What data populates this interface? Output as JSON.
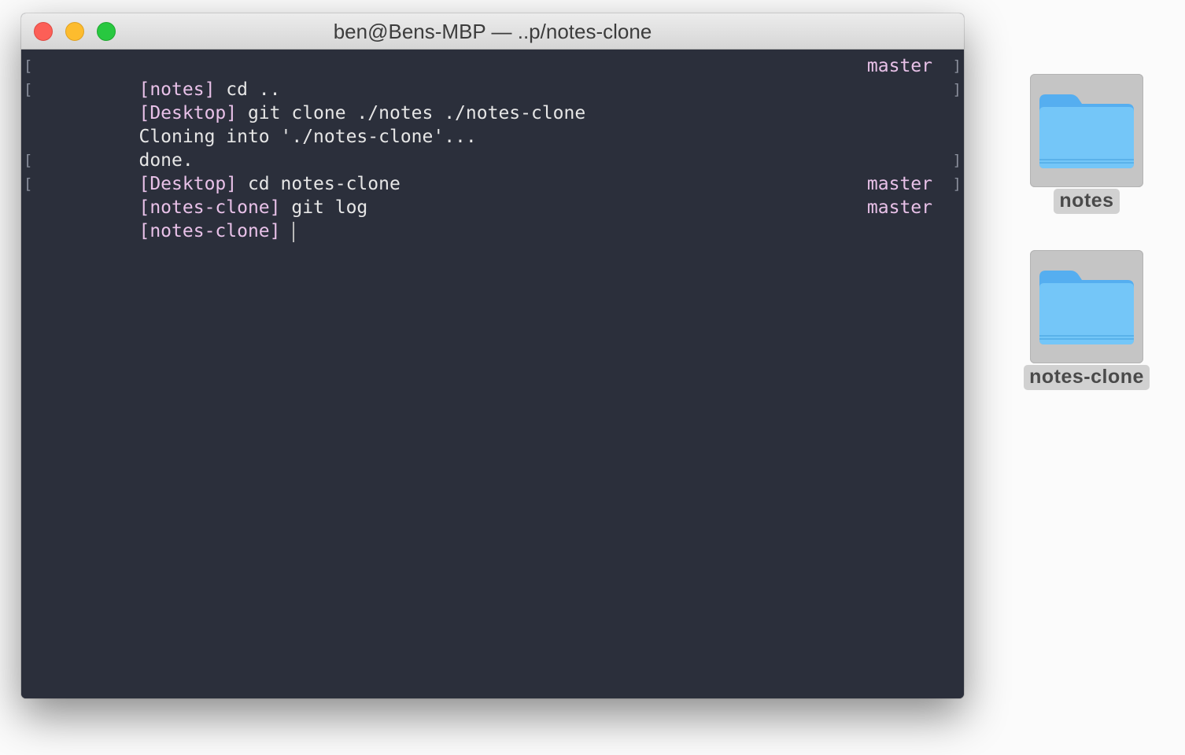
{
  "window": {
    "title": "ben@Bens-MBP — ..p/notes-clone",
    "controls": {
      "close": "close-button",
      "minimize": "minimize-button",
      "zoom": "zoom-button"
    }
  },
  "terminal": {
    "lines": [
      {
        "prompt": "[notes]",
        "command": " cd ..",
        "branch": "master",
        "open_mark": "[",
        "close_mark": "]"
      },
      {
        "prompt": "[Desktop]",
        "command": " git clone ./notes ./notes-clone",
        "branch": "",
        "open_mark": "[",
        "close_mark": "]"
      },
      {
        "output": "Cloning into './notes-clone'..."
      },
      {
        "output": "done."
      },
      {
        "prompt": "[Desktop]",
        "command": " cd notes-clone",
        "branch": "",
        "open_mark": "[",
        "close_mark": "]"
      },
      {
        "prompt": "[notes-clone]",
        "command": " git log",
        "branch": "master",
        "open_mark": "[",
        "close_mark": "]"
      },
      {
        "prompt": "[notes-clone]",
        "command": " ",
        "branch": "master"
      }
    ]
  },
  "desktop": {
    "icons": [
      {
        "label": "notes",
        "icon": "folder-icon"
      },
      {
        "label": "notes-clone",
        "icon": "folder-icon"
      }
    ]
  },
  "colors": {
    "terminal_bg": "#2b2f3b",
    "prompt": "#e8c1e8",
    "text": "#e6e6e6",
    "folder": "#6fc3f7"
  }
}
